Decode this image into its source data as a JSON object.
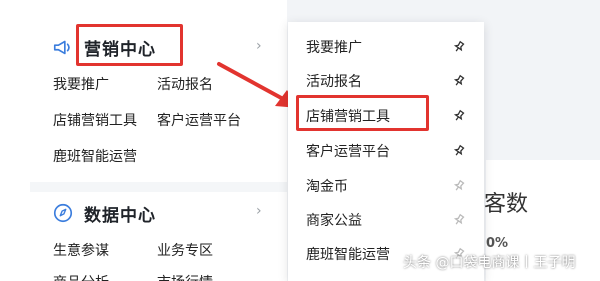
{
  "sidebar": {
    "marketing": {
      "title": "营销中心",
      "items": [
        "我要推广",
        "活动报名",
        "店铺营销工具",
        "客户运营平台",
        "鹿班智能运营"
      ]
    },
    "data": {
      "title": "数据中心",
      "items": [
        "生意参谋",
        "业务专区",
        "商品分析",
        "市场行情"
      ]
    }
  },
  "menu": {
    "items": [
      "我要推广",
      "活动报名",
      "店铺营销工具",
      "客户运营平台",
      "淘金币",
      "商家公益",
      "鹿班智能运营"
    ]
  },
  "background": {
    "big_text": "客数",
    "small_text": "0%"
  },
  "watermark": "头条 @口袋电商课丨王子明",
  "colors": {
    "highlight": "#e2342f",
    "accent": "#3b7ddd"
  }
}
